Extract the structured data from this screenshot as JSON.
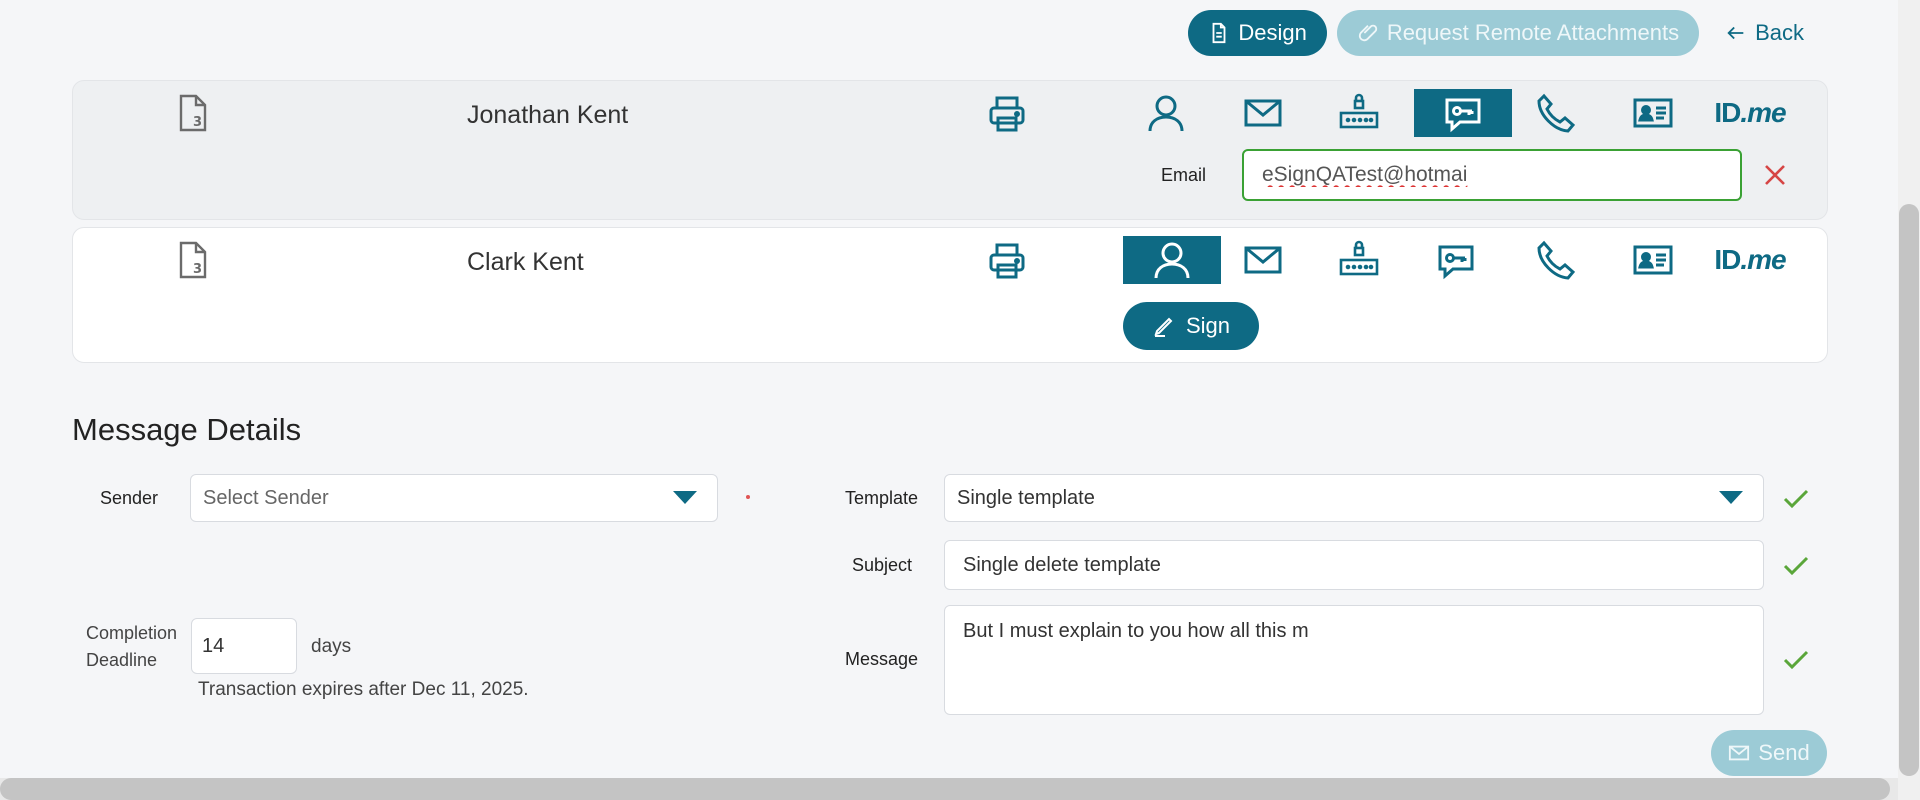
{
  "toolbar": {
    "design_label": "Design",
    "request_label": "Request Remote Attachments",
    "back_label": "Back"
  },
  "recipients": [
    {
      "name": "Jonathan Kent",
      "active_method": "sms-key",
      "email_label": "Email",
      "email_value": "eSignQATest@hotmai",
      "idme_text": "ID",
      "idme_suffix": ".me"
    },
    {
      "name": "Clark Kent",
      "active_method": "person",
      "sign_label": "Sign",
      "idme_text": "ID",
      "idme_suffix": ".me"
    }
  ],
  "message_details": {
    "title": "Message Details",
    "sender_label": "Sender",
    "sender_placeholder": "Select Sender",
    "template_label": "Template",
    "template_value": "Single template",
    "subject_label": "Subject",
    "subject_value": "Single delete template",
    "message_label": "Message",
    "message_value": "But I must explain to you how all this m",
    "deadline_label_1": "Completion",
    "deadline_label_2": "Deadline",
    "deadline_value": "14",
    "days_label": "days",
    "expires_text": "Transaction expires after Dec 11, 2025."
  },
  "send_label": "Send",
  "colors": {
    "accent": "#0e6a84",
    "accent_disabled": "#9ccbd6",
    "valid_green": "#5aa63a",
    "error_red": "#d64545"
  }
}
